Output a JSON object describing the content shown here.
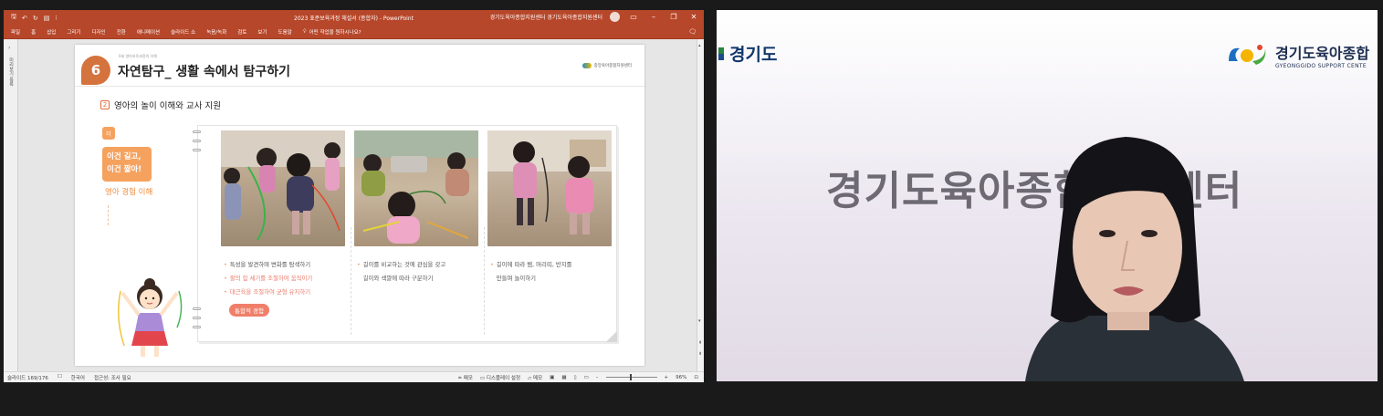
{
  "ppt": {
    "qat_icons": [
      "save-icon",
      "undo-icon",
      "redo-icon",
      "present-icon"
    ],
    "doc_title": "2023 표준보육과정 해설서 (종합자)  -  PowerPoint",
    "account_name": "경기도육아종합지원센터 경기도육아종합지원센터",
    "ribbon_tabs": [
      "파일",
      "홈",
      "삽입",
      "그리기",
      "디자인",
      "전환",
      "애니메이션",
      "슬라이드 쇼",
      "녹음/녹화",
      "검토",
      "보기",
      "도움말"
    ],
    "tell_me": "어떤 작업을 원하시나요?",
    "thumb_label": "미리보기 목록",
    "status": {
      "slide_info": "슬라이드 169/176",
      "language": "한국어",
      "accessibility": "접근성: 조사 필요",
      "notes": "메모",
      "display_settings": "디스플레이 설정",
      "comments": "메모",
      "zoom": "96%"
    }
  },
  "slide": {
    "number": "6",
    "breadcrumb": "0세 영아보육과정의 이해",
    "title": "자연탐구_ 생활 속에서 탐구하기",
    "logo_text": "중앙육아종합지원센터",
    "section_num": "2",
    "section_title": "영아의 놀이 이해와 교사 지원",
    "chip": "더",
    "theme_line1": "이건 길고,",
    "theme_line2": "이건 짧아!",
    "theme_sub": "영아 경험 이해",
    "columns": [
      {
        "bullets": [
          {
            "text": "특성을 발견하며 변화를 탐색하기",
            "highlight": false
          },
          {
            "text": "팔의 힘 세기를 조절하여 움직이기",
            "highlight": true
          },
          {
            "text": "대근육을 조절하여 균형 유지하기",
            "highlight": true
          }
        ],
        "pill": "통합적 경험"
      },
      {
        "bullets": [
          {
            "text": "길이를 비교하는 것에 관심을 갖고",
            "highlight": false
          },
          {
            "text": "길이와 색깔에 따라 구분하기",
            "highlight": false,
            "nobullet": true
          }
        ]
      },
      {
        "bullets": [
          {
            "text": "길이에 따라 뱀, 머리띠, 반지를",
            "highlight": false
          },
          {
            "text": "만들며 놀이하기",
            "highlight": false,
            "nobullet": true
          }
        ]
      }
    ]
  },
  "video": {
    "left_logo": "경기도",
    "center_logo_title": "경기도육아종합",
    "center_logo_sub": "GYEONGGIDO SUPPORT CENTE",
    "banner": "경기도육아종합지원센터"
  },
  "colors": {
    "ppt_accent": "#b7472a",
    "slide_orange": "#d4733d",
    "theme_orange": "#f5a25f",
    "pill_red": "#f07f6a"
  }
}
